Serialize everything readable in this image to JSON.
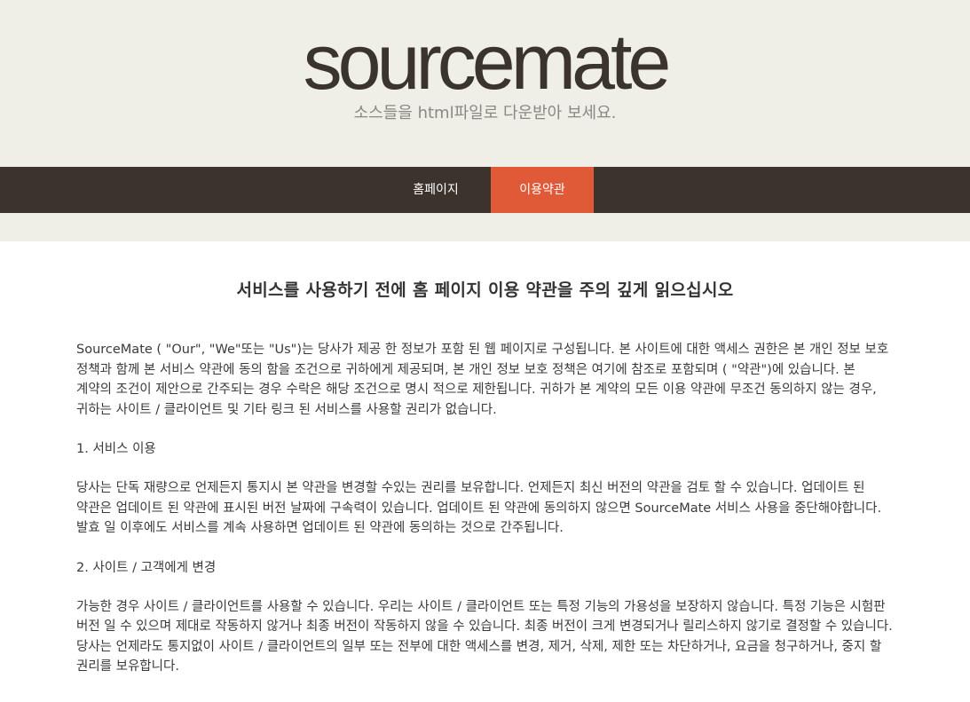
{
  "header": {
    "logo": "sourcemate",
    "tagline": "소스들을 html파일로 다운받아 보세요."
  },
  "nav": {
    "home": "홈페이지",
    "terms": "이용약관"
  },
  "main": {
    "title": "서비스를 사용하기 전에 홈 페이지 이용 약관을 주의 깊게 읽으십시오",
    "intro": "SourceMate ( \"Our\", \"We\"또는 \"Us\")는 당사가 제공 한 정보가 포함 된 웹 페이지로 구성됩니다. 본 사이트에 대한 액세스 권한은 본 개인 정보 보호 정책과 함께 본 서비스 약관에 동의 함을 조건으로 귀하에게 제공되며, 본 개인 정보 보호 정책은 여기에 참조로 포함되며 ( \"약관\")에 있습니다. 본 계약의 조건이 제안으로 간주되는 경우 수락은 해당 조건으로 명시 적으로 제한됩니다. 귀하가 본 계약의 모든 이용 약관에 무조건 동의하지 않는 경우, 귀하는 사이트 / 클라이언트 및 기타 링크 된 서비스를 사용할 권리가 없습니다.",
    "section1_heading": "1. 서비스 이용",
    "section1_body": "당사는 단독 재량으로 언제든지 통지시 본 약관을 변경할 수있는 권리를 보유합니다. 언제든지 최신 버전의 약관을 검토 할 수 있습니다. 업데이트 된 약관은 업데이트 된 약관에 표시된 버전 날짜에 구속력이 있습니다. 업데이트 된 약관에 동의하지 않으면 SourceMate 서비스 사용을 중단해야합니다. 발효 일 이후에도 서비스를 계속 사용하면 업데이트 된 약관에 동의하는 것으로 간주됩니다.",
    "section2_heading": "2. 사이트 / 고객에게 변경",
    "section2_body": "가능한 경우 사이트 / 클라이언트를 사용할 수 있습니다. 우리는 사이트 / 클라이언트 또는 특정 기능의 가용성을 보장하지 않습니다. 특정 기능은 시험판 버전 일 수 있으며 제대로 작동하지 않거나 최종 버전이 작동하지 않을 수 있습니다. 최종 버전이 크게 변경되거나 릴리스하지 않기로 결정할 수 있습니다. 당사는 언제라도 통지없이 사이트 / 클라이언트의 일부 또는 전부에 대한 액세스를 변경, 제거, 삭제, 제한 또는 차단하거나, 요금을 청구하거나, 중지 할 권리를 보유합니다."
  }
}
